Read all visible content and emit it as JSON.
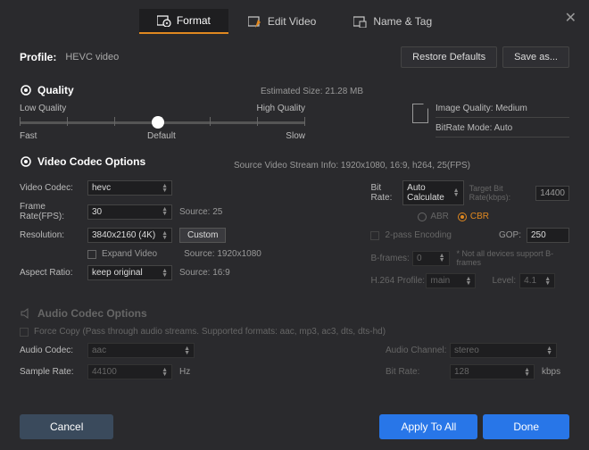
{
  "tabs": {
    "format": "Format",
    "edit": "Edit Video",
    "name": "Name & Tag"
  },
  "profile": {
    "label": "Profile:",
    "name": "HEVC video",
    "restore": "Restore Defaults",
    "saveas": "Save as..."
  },
  "quality": {
    "title": "Quality",
    "estimated": "Estimated Size: 21.28 MB",
    "low": "Low Quality",
    "high": "High Quality",
    "fast": "Fast",
    "default": "Default",
    "slow": "Slow",
    "image_quality": "Image Quality: Medium",
    "bitrate_mode": "BitRate Mode: Auto"
  },
  "video": {
    "title": "Video Codec Options",
    "source_info": "Source Video Stream Info: 1920x1080, 16:9, h264, 25(FPS)",
    "codec_lbl": "Video Codec:",
    "codec": "hevc",
    "fps_lbl": "Frame Rate(FPS):",
    "fps": "30",
    "fps_src": "Source: 25",
    "res_lbl": "Resolution:",
    "res": "3840x2160 (4K)",
    "custom": "Custom",
    "expand": "Expand Video",
    "res_src": "Source: 1920x1080",
    "aspect_lbl": "Aspect Ratio:",
    "aspect": "keep original",
    "aspect_src": "Source: 16:9",
    "bitrate_lbl": "Bit Rate:",
    "bitrate": "Auto Calculate",
    "target_lbl": "Target Bit Rate(kbps):",
    "target": "14400",
    "abr": "ABR",
    "cbr": "CBR",
    "twopass": "2-pass Encoding",
    "gop_lbl": "GOP:",
    "gop": "250",
    "bframes_lbl": "B-frames:",
    "bframes": "0",
    "bframes_note": "* Not all devices support B-frames",
    "profile_lbl": "H.264 Profile:",
    "profile": "main",
    "level_lbl": "Level:",
    "level": "4.1"
  },
  "audio": {
    "title": "Audio Codec Options",
    "force": "Force Copy (Pass through audio streams. Supported formats: aac, mp3, ac3, dts, dts-hd)",
    "codec_lbl": "Audio Codec:",
    "codec": "aac",
    "rate_lbl": "Sample Rate:",
    "rate": "44100",
    "hz": "Hz",
    "channel_lbl": "Audio Channel:",
    "channel": "stereo",
    "bitrate_lbl": "Bit Rate:",
    "bitrate": "128",
    "kbps": "kbps"
  },
  "footer": {
    "cancel": "Cancel",
    "apply": "Apply To All",
    "done": "Done"
  }
}
